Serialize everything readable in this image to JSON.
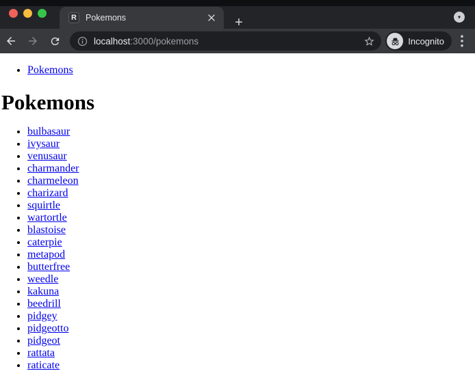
{
  "window": {
    "controls": {
      "close": "close",
      "minimize": "minimize",
      "zoom": "zoom"
    }
  },
  "browser": {
    "tab": {
      "title": "Pokemons",
      "favicon_letter": "R"
    },
    "tab_strip": {
      "new_tab_icon": "+",
      "overview_icon": "▼"
    },
    "toolbar": {
      "url_host": "localhost",
      "url_rest": ":3000/pokemons",
      "incognito_label": "Incognito"
    }
  },
  "colors": {
    "link_blue": "#0000ee",
    "traffic_red": "#f0625a",
    "traffic_yellow": "#f6bc3e",
    "traffic_green": "#37c648",
    "page_bg": "#ffffff"
  },
  "page": {
    "nav_links": [
      "Pokemons"
    ],
    "heading": "Pokemons",
    "pokemons": [
      "bulbasaur",
      "ivysaur",
      "venusaur",
      "charmander",
      "charmeleon",
      "charizard",
      "squirtle",
      "wartortle",
      "blastoise",
      "caterpie",
      "metapod",
      "butterfree",
      "weedle",
      "kakuna",
      "beedrill",
      "pidgey",
      "pidgeotto",
      "pidgeot",
      "rattata",
      "raticate"
    ]
  }
}
